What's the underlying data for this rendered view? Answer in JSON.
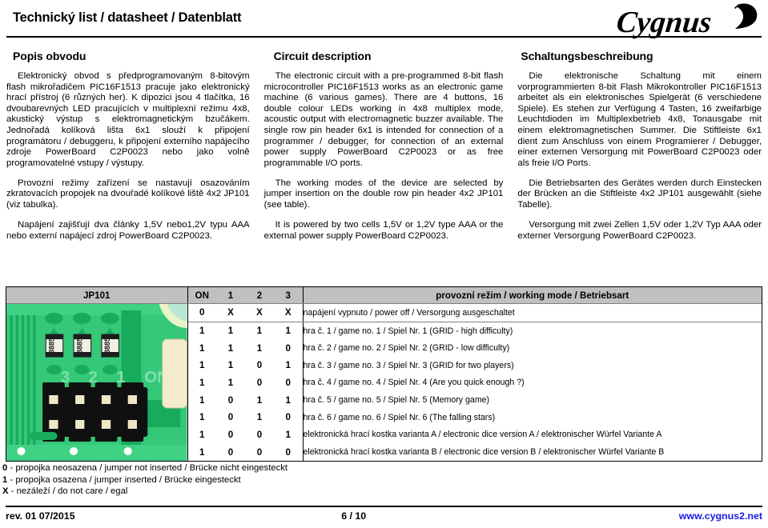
{
  "header": {
    "title": "Technický list / datasheet / Datenblatt",
    "logo_text": "Cygnus",
    "logo_name": "cygnus-swan-logo"
  },
  "columns": {
    "cz": {
      "heading": "Popis obvodu",
      "paragraphs": [
        "Elektronický obvod s předprogramovaným 8-bitovým flash mikrořadičem PIC16F1513 pracuje jako elektronický hrací přístroj (6 různých her). K dipozici jsou 4 tlačítka, 16 dvoubarevných LED pracujících v multiplexní režimu 4x8, akustický výstup s elektromagnetickým bzučákem. Jednořadá kolíková lišta 6x1 slouží k připojení programátoru / debuggeru, k připojení externího napájecího zdroje PowerBoard C2P0023 nebo jako volně programovatelné vstupy / výstupy.",
        "Provozní režimy zařízení se nastavují osazováním zkratovacích propojek na dvouřadé kolíkové liště 4x2 JP101 (viz tabulka).",
        "Napájení zajišťují dva články 1,5V nebo1,2V typu AAA nebo externí napájecí zdroj PowerBoard C2P0023."
      ]
    },
    "en": {
      "heading": "Circuit description",
      "paragraphs": [
        "The electronic circuit with a pre-programmed 8-bit flash microcontroller PIC16F1513 works as an electronic game machine (6 various games). There are 4 buttons, 16 double colour LEDs working in 4x8 multiplex mode, acoustic output with electromagnetic buzzer available. The single row pin header 6x1 is intended for connection of a programmer / debugger, for connection of an external power supply PowerBoard C2P0023 or as free programmable I/O ports.",
        "The working modes of the device are selected by jumper insertion on the double row pin header 4x2 JP101 (see table).",
        "It is powered by two cells 1,5V or 1,2V type AAA or the external power supply PowerBoard C2P0023."
      ]
    },
    "de": {
      "heading": "Schaltungsbeschreibung",
      "paragraphs": [
        "Die elektronische Schaltung mit einem vorprogrammierten 8-bit Flash Mikrokontroller PIC16F1513 arbeitet als ein elektronisches Spielgerät (6 verschiedene Spiele). Es stehen zur Verfügung 4 Tasten, 16 zweifarbige Leuchtdioden im Multiplexbetrieb 4x8, Tonausgabe mit einem elektromagnetischen Summer. Die Stiftleiste 6x1 dient zum Anschluss von einem Programierer / Debugger, einer externen Versorgung mit PowerBoard C2P0023 oder als freie I/O Ports.",
        "Die Betriebsarten des Gerätes werden durch Einstecken der Brücken an die Stiftleiste 4x2 JP101 ausgewählt (siehe Tabelle).",
        "Versorgung mit zwei Zellen 1,5V oder 1,2V Typ AAA oder externer Versorgung PowerBoard C2P0023."
      ]
    }
  },
  "table": {
    "headers": {
      "jp": "JP101",
      "on": "ON",
      "b1": "1",
      "b2": "2",
      "b3": "3",
      "mode": "provozní režim / working mode / Betriebsart"
    },
    "pcb": {
      "label_3": "3",
      "label_2": "2",
      "label_1": "1",
      "label_on": "ON",
      "resistor_text": "8885"
    },
    "rows": [
      {
        "on": "0",
        "b1": "X",
        "b2": "X",
        "b3": "X",
        "desc": "napájení vypnuto / power off / Versorgung ausgeschaltet"
      },
      {
        "on": "1",
        "b1": "1",
        "b2": "1",
        "b3": "1",
        "desc": "hra č. 1 / game no. 1 / Spiel Nr. 1 (GRID - high difficulty)"
      },
      {
        "on": "1",
        "b1": "1",
        "b2": "1",
        "b3": "0",
        "desc": "hra č. 2 / game no. 2 / Spiel Nr. 2 (GRID - low difficulty)"
      },
      {
        "on": "1",
        "b1": "1",
        "b2": "0",
        "b3": "1",
        "desc": "hra č. 3 / game no. 3 / Spiel Nr. 3 (GRID for two players)"
      },
      {
        "on": "1",
        "b1": "1",
        "b2": "0",
        "b3": "0",
        "desc": "hra č. 4 / game no. 4 / Spiel Nr. 4 (Are you quick enough ?)"
      },
      {
        "on": "1",
        "b1": "0",
        "b2": "1",
        "b3": "1",
        "desc": "hra č. 5 / game no. 5 / Spiel Nr. 5 (Memory game)"
      },
      {
        "on": "1",
        "b1": "0",
        "b2": "1",
        "b3": "0",
        "desc": "hra č. 6 / game no. 6 / Spiel Nr. 6 (The falling stars)"
      },
      {
        "on": "1",
        "b1": "0",
        "b2": "0",
        "b3": "1",
        "desc": "elektronická hrací kostka varianta A / electronic dice version A / elektronischer Würfel Variante A"
      },
      {
        "on": "1",
        "b1": "0",
        "b2": "0",
        "b3": "0",
        "desc": "elektronická hrací kostka varianta B / electronic dice version B / elektronischer Würfel Variante B"
      }
    ]
  },
  "legend": [
    {
      "key": "0",
      "text": " - propojka neosazena / jumper not inserted / Brücke nicht eingesteckt"
    },
    {
      "key": "1",
      "text": " - propojka osazena / jumper inserted / Brücke eingesteckt"
    },
    {
      "key": "X",
      "text": " - nezáleží / do not care / egal"
    }
  ],
  "footer": {
    "revision": "rev. 01  07/2015",
    "page": "6 / 10",
    "website": "www.cygnus2.net"
  },
  "colors": {
    "header_band": "#c0c0c0",
    "pcb_green": "#2fbf6e",
    "pcb_green_dark": "#14a05a",
    "link_blue": "#1a1ae6"
  }
}
